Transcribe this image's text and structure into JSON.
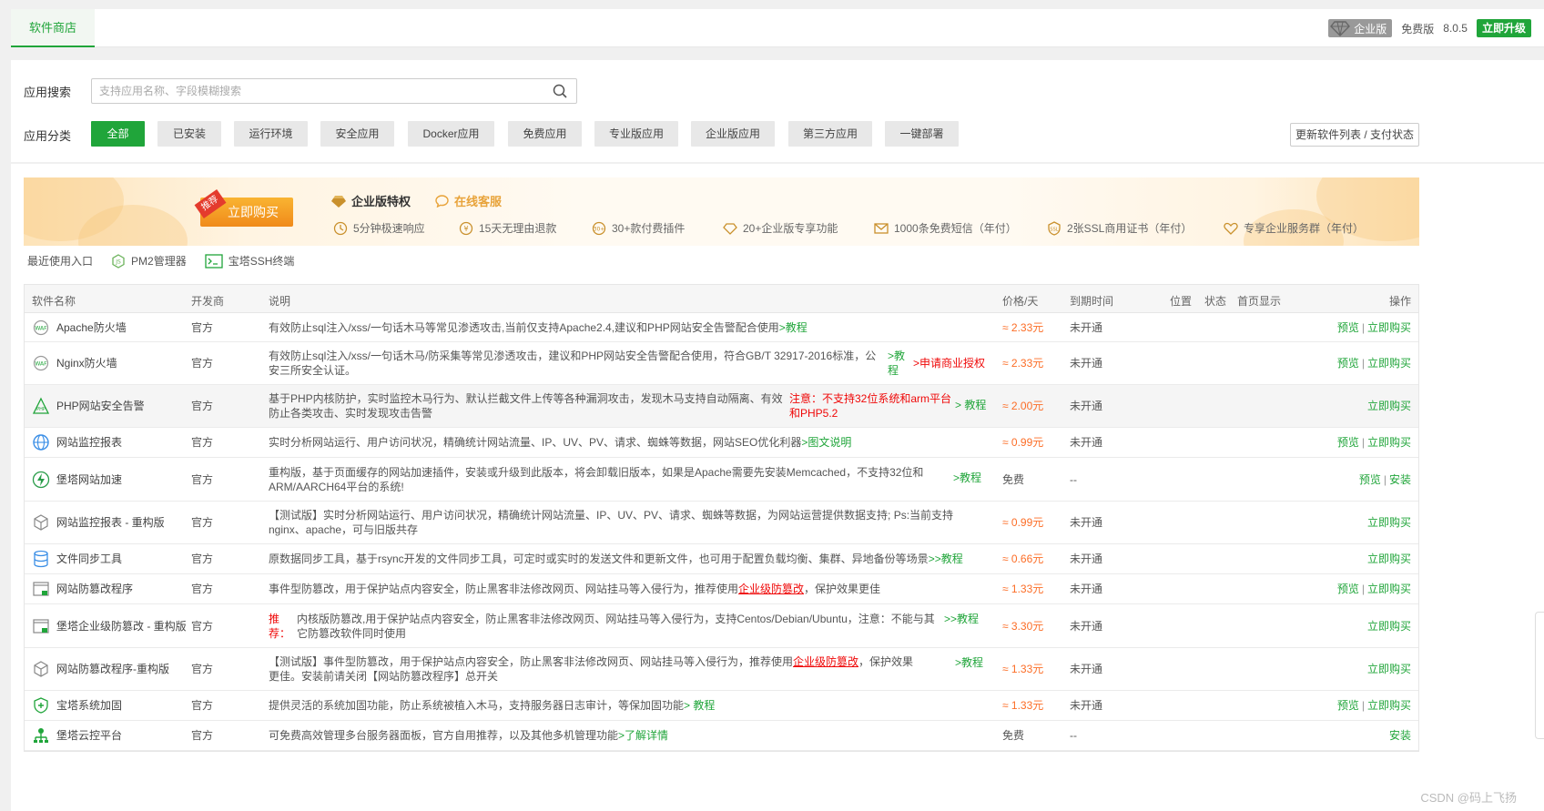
{
  "topbar": {
    "tab_store": "软件商店",
    "edition_badge": "企业版",
    "free_edition": "免费版",
    "version": "8.0.5",
    "upgrade_button": "立即升级"
  },
  "search": {
    "label": "应用搜索",
    "placeholder": "支持应用名称、字段模糊搜索"
  },
  "categories": {
    "label": "应用分类",
    "items": [
      "全部",
      "已安装",
      "运行环境",
      "安全应用",
      "Docker应用",
      "免费应用",
      "专业版应用",
      "企业版应用",
      "第三方应用",
      "一键部署"
    ],
    "active": "全部"
  },
  "update_button": "更新软件列表 / 支付状态",
  "banner": {
    "ribbon": "推荐",
    "buy_button": "立即购买",
    "title": "企业版特权",
    "online_service": "在线客服",
    "features": [
      "5分钟极速响应",
      "15天无理由退款",
      "30+款付费插件",
      "20+企业版专享功能",
      "1000条免费短信（年付）",
      "2张SSL商用证书（年付）",
      "专享企业服务群（年付）"
    ]
  },
  "recent": {
    "label": "最近使用入口",
    "items": [
      "PM2管理器",
      "宝塔SSH终端"
    ]
  },
  "table": {
    "headers": {
      "name": "软件名称",
      "developer": "开发商",
      "desc": "说明",
      "price": "价格/天",
      "expire": "到期时间",
      "position": "位置",
      "status": "状态",
      "homepage": "首页显示",
      "ops": "操作"
    },
    "rows": [
      {
        "name": "Apache防火墙",
        "dev": "官方",
        "desc": "有效防止sql注入/xss/一句话木马等常见渗透攻击,当前仅支持Apache2.4,建议和PHP网站安全告警配合使用",
        "link": ">教程",
        "price": "≈ 2.33元",
        "expire": "未开通",
        "op1": "预览",
        "op2": "立即购买"
      },
      {
        "name": "Nginx防火墙",
        "dev": "官方",
        "desc": "有效防止sql注入/xss/一句话木马/防采集等常见渗透攻击，建议和PHP网站安全告警配合使用，符合GB/T 32917-2016标准，公安三所安全认证。",
        "link": ">教程",
        "link2": ">申请商业授权",
        "price": "≈ 2.33元",
        "expire": "未开通",
        "op1": "预览",
        "op2": "立即购买"
      },
      {
        "name": "PHP网站安全告警",
        "dev": "官方",
        "desc": "基于PHP内核防护，实时监控木马行为、默认拦截文件上传等各种漏洞攻击，发现木马支持自动隔离、有效防止各类攻击、实时发现攻击告警",
        "warn": "注意：不支持32位系统和arm平台和PHP5.2",
        "link": "> 教程",
        "price": "≈ 2.00元",
        "expire": "未开通",
        "op1": "",
        "op2": "立即购买"
      },
      {
        "name": "网站监控报表",
        "dev": "官方",
        "desc": "实时分析网站运行、用户访问状况，精确统计网站流量、IP、UV、PV、请求、蜘蛛等数据，网站SEO优化利器",
        "link": ">图文说明",
        "price": "≈ 0.99元",
        "expire": "未开通",
        "op1": "预览",
        "op2": "立即购买"
      },
      {
        "name": "堡塔网站加速",
        "dev": "官方",
        "desc": "重构版，基于页面缓存的网站加速插件，安装或升级到此版本，将会卸载旧版本，如果是Apache需要先安装Memcached，不支持32位和ARM/AARCH64平台的系统!",
        "link": ">教程",
        "price": "免费",
        "expire": "--",
        "op1": "预览",
        "op2": "安装"
      },
      {
        "name": "网站监控报表 - 重构版",
        "dev": "官方",
        "desc": "【测试版】实时分析网站运行、用户访问状况，精确统计网站流量、IP、UV、PV、请求、蜘蛛等数据，为网站运营提供数据支持; Ps:当前支持nginx、apache，可与旧版共存",
        "link": "",
        "price": "≈ 0.99元",
        "expire": "未开通",
        "op1": "",
        "op2": "立即购买"
      },
      {
        "name": "文件同步工具",
        "dev": "官方",
        "desc": "原数据同步工具，基于rsync开发的文件同步工具，可定时或实时的发送文件和更新文件，也可用于配置负载均衡、集群、异地备份等场景",
        "link": ">>教程",
        "price": "≈ 0.66元",
        "expire": "未开通",
        "op1": "",
        "op2": "立即购买"
      },
      {
        "name": "网站防篡改程序",
        "dev": "官方",
        "desc": "事件型防篡改，用于保护站点内容安全，防止黑客非法修改网页、网站挂马等入侵行为，推荐使用",
        "redlink": "企业级防篡改",
        "desc_tail": "，保护效果更佳",
        "link": "",
        "price": "≈ 1.33元",
        "expire": "未开通",
        "op1": "预览",
        "op2": "立即购买"
      },
      {
        "name": "堡塔企业级防篡改 - 重构版",
        "dev": "官方",
        "rec": "推荐：",
        "desc": "内核版防篡改,用于保护站点内容安全，防止黑客非法修改网页、网站挂马等入侵行为，支持Centos/Debian/Ubuntu，注意：不能与其它防篡改软件同时使用",
        "link": ">>教程",
        "price": "≈ 3.30元",
        "expire": "未开通",
        "op1": "",
        "op2": "立即购买"
      },
      {
        "name": "网站防篡改程序-重构版",
        "dev": "官方",
        "desc": "【测试版】事件型防篡改，用于保护站点内容安全，防止黑客非法修改网页、网站挂马等入侵行为，推荐使用",
        "redlink": "企业级防篡改",
        "desc_tail": "，保护效果更佳。安装前请关闭【网站防篡改程序】总开关",
        "link": ">教程",
        "price": "≈ 1.33元",
        "expire": "未开通",
        "op1": "",
        "op2": "立即购买"
      },
      {
        "name": "宝塔系统加固",
        "dev": "官方",
        "desc": "提供灵活的系统加固功能，防止系统被植入木马，支持服务器日志审计，等保加固功能",
        "link": "> 教程",
        "price": "≈ 1.33元",
        "expire": "未开通",
        "op1": "预览",
        "op2": "立即购买"
      },
      {
        "name": "堡塔云控平台",
        "dev": "官方",
        "desc": "可免费高效管理多台服务器面板，官方自用推荐，以及其他多机管理功能",
        "link": ">了解详情",
        "price": "免费",
        "expire": "--",
        "op1": "",
        "op2": "安装"
      }
    ]
  },
  "watermark": "CSDN @码上飞扬"
}
